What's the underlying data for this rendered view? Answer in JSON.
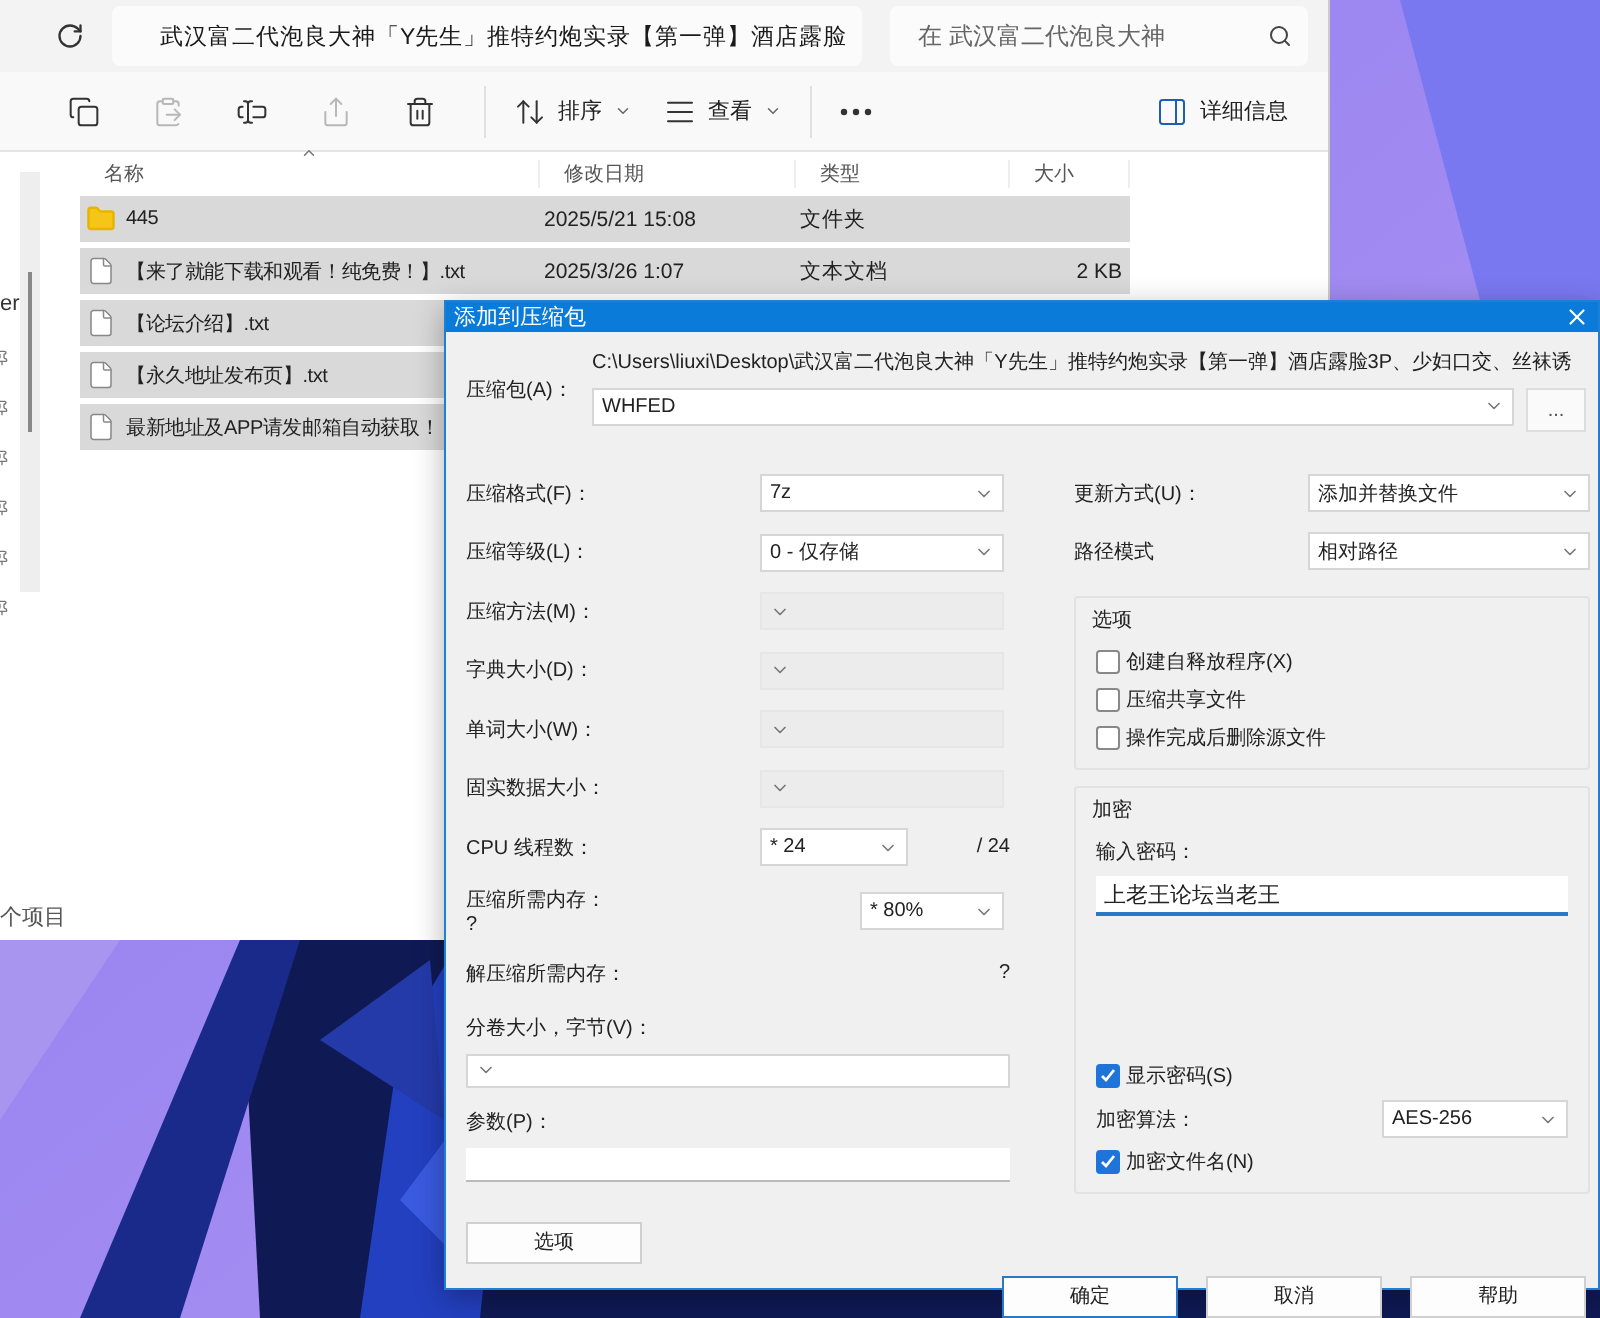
{
  "explorer": {
    "address": "武汉富二代泡良大神「Y先生」推特约炮实录【第一弹】酒店露脸",
    "search_placeholder": "在 武汉富二代泡良大神",
    "toolbar": [
      {
        "kind": "copy",
        "disabled": false
      },
      {
        "kind": "paste",
        "disabled": true
      },
      {
        "kind": "rename",
        "disabled": false
      },
      {
        "kind": "share",
        "disabled": true
      },
      {
        "kind": "delete",
        "disabled": false
      },
      {
        "kind": "sort",
        "label": "排序",
        "disabled": false
      },
      {
        "kind": "view",
        "label": "查看",
        "disabled": false
      },
      {
        "kind": "more",
        "disabled": false
      }
    ],
    "details": "详细信息",
    "sidebar_text": "er",
    "columns": [
      "名称",
      "修改日期",
      "类型",
      "大小"
    ],
    "files": [
      {
        "kind": "folder",
        "name": "445",
        "date": "2025/5/21 15:08",
        "type": "文件夹",
        "selected": true
      },
      {
        "kind": "file",
        "name": "【来了就能下载和观看！纯免费！】.txt",
        "date": "2025/3/26 1:07",
        "type": "文本文档",
        "size": "2 KB",
        "selected": true
      },
      {
        "kind": "file",
        "name": "【论坛介绍】.txt",
        "selected": true
      },
      {
        "kind": "file",
        "name": "【永久地址发布页】.txt",
        "selected": true
      },
      {
        "kind": "file",
        "name": "最新地址及APP请发邮箱自动获取！",
        "selected": true
      }
    ],
    "status": "个项目"
  },
  "dialog": {
    "title": "添加到压缩包",
    "archive_label": "压缩包(A)：",
    "archive_path": "C:\\Users\\liuxi\\Desktop\\武汉富二代泡良大神「Y先生」推特约炮实录【第一弹】酒店露脸3P、少妇口交、丝袜诱",
    "archive_name": "WHFED",
    "browse": "...",
    "left": [
      {
        "kind": "select",
        "label": "压缩格式(F)：",
        "value": "7z",
        "disabled": false
      },
      {
        "kind": "select",
        "label": "压缩等级(L)：",
        "value": "0 - 仅存储",
        "disabled": false
      },
      {
        "kind": "select",
        "label": "压缩方法(M)：",
        "disabled": true
      },
      {
        "kind": "select",
        "label": "字典大小(D)：",
        "disabled": true
      },
      {
        "kind": "select",
        "label": "单词大小(W)：",
        "disabled": true
      },
      {
        "kind": "select",
        "label": "固实数据大小：",
        "disabled": true
      },
      {
        "kind": "threads",
        "label": "CPU 线程数：",
        "value": "* 24",
        "suffix": "/ 24"
      },
      {
        "kind": "memory",
        "label": "压缩所需内存：",
        "note": "?",
        "value": "* 80%"
      },
      {
        "kind": "info",
        "label": "解压缩所需内存：",
        "value": "?"
      }
    ],
    "volume_label": "分卷大小，字节(V)：",
    "params_label": "参数(P)：",
    "options_button": "选项",
    "right": [
      {
        "label": "更新方式(U)：",
        "value": "添加并替换文件"
      },
      {
        "label": "路径模式",
        "value": "相对路径"
      }
    ],
    "options": {
      "title": "选项",
      "items": [
        {
          "label": "创建自释放程序(X)",
          "checked": false
        },
        {
          "label": "压缩共享文件",
          "checked": false
        },
        {
          "label": "操作完成后删除源文件",
          "checked": false
        }
      ]
    },
    "encryption": {
      "title": "加密",
      "password_label": "输入密码：",
      "password": "上老王论坛当老王",
      "show_password": {
        "label": "显示密码(S)",
        "checked": true
      },
      "method_label": "加密算法：",
      "method": "AES-256",
      "encrypt_names": {
        "label": "加密文件名(N)",
        "checked": true
      }
    },
    "buttons": [
      {
        "label": "确定",
        "default": true
      },
      {
        "label": "取消",
        "default": false
      },
      {
        "label": "帮助",
        "default": false
      }
    ]
  }
}
